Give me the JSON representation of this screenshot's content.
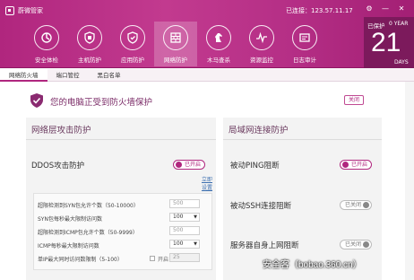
{
  "app": {
    "brand_name": "蔚微管家",
    "ip_label": "已连接：123.57.11.17"
  },
  "window_controls": [
    "gear",
    "minimize",
    "close"
  ],
  "nav": [
    {
      "label": "安全体检",
      "icon": "scan-icon"
    },
    {
      "label": "主机防护",
      "icon": "host-shield-icon"
    },
    {
      "label": "应用防护",
      "icon": "app-shield-icon"
    },
    {
      "label": "网络防护",
      "icon": "network-icon",
      "active": true
    },
    {
      "label": "木马查杀",
      "icon": "horse-icon"
    },
    {
      "label": "资源监控",
      "icon": "monitor-icon"
    },
    {
      "label": "日志审计",
      "icon": "log-icon"
    }
  ],
  "date_box": {
    "protected": "已保护",
    "year": "0 YEAR",
    "days": "21",
    "unit": "DAYS"
  },
  "subtabs": [
    "网络防火墙",
    "端口管控",
    "黑白名单"
  ],
  "status": {
    "text": "您的电脑正受到防火墙保护",
    "close_button": "关闭"
  },
  "left_panel": {
    "title": "网络层攻击防护",
    "ddos_label": "DDOS攻击防护",
    "ddos_toggle": "已开启",
    "advanced_link": "立即设置",
    "settings": [
      {
        "label": "超限检测到SYN包允许个数（50-10000）",
        "type": "input",
        "value": "500"
      },
      {
        "label": "SYN包每秒最大限制访问数",
        "type": "select",
        "value": "100"
      },
      {
        "label": "超限检测到ICMP包允许个数（50-9999）",
        "type": "input",
        "value": "500"
      },
      {
        "label": "ICMP每秒最大限制访问数",
        "type": "select",
        "value": "100"
      },
      {
        "label": "单IP最大同时访问数限制（5-100）",
        "type": "checkbox-input",
        "check_label": "开启",
        "value": "25"
      }
    ]
  },
  "right_panel": {
    "title": "局域网连接防护",
    "rows": [
      {
        "label": "被动PING阻断",
        "toggle": "已开启",
        "on": true
      },
      {
        "label": "被动SSH连接阻断",
        "toggle": "已关闭",
        "on": false
      },
      {
        "label": "服务器自身上网阻断",
        "toggle": "已关闭",
        "on": false
      }
    ]
  },
  "watermark": "安全客（bobao.360.cn）",
  "colors": {
    "accent": "#b0267e",
    "header_dark": "#7c1a5c"
  }
}
